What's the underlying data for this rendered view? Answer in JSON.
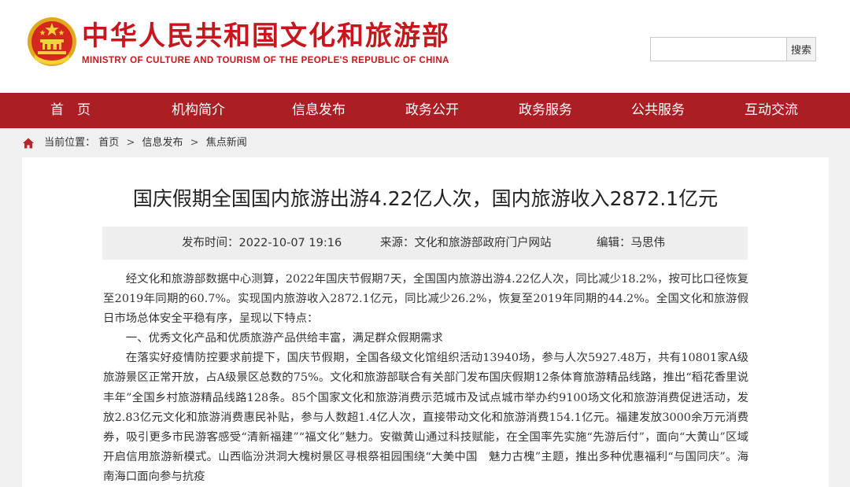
{
  "header": {
    "site_title_cn": "中华人民共和国文化和旅游部",
    "site_title_en": "MINISTRY OF CULTURE AND TOURISM OF THE PEOPLE'S REPUBLIC OF CHINA",
    "emblem_icon": "national-emblem-icon",
    "brand_color": "#c8161d"
  },
  "search": {
    "placeholder": "",
    "value": "",
    "button_label": "搜索"
  },
  "nav": {
    "background": "#ab1f24",
    "items": [
      "首　页",
      "机构简介",
      "信息发布",
      "政务公开",
      "政务服务",
      "公共服务",
      "互动交流"
    ]
  },
  "breadcrumb": {
    "icon": "home-icon",
    "prefix": "当前位置：",
    "items": [
      "首页",
      "信息发布",
      "焦点新闻"
    ],
    "separator": ">"
  },
  "article": {
    "title": "国庆假期全国国内旅游出游4.22亿人次，国内旅游收入2872.1亿元",
    "meta": {
      "publish_time_label": "发布时间：",
      "publish_time": "2022-10-07 19:16",
      "source_label": "来源：",
      "source": "文化和旅游部政府门户网站",
      "editor_label": "编辑：",
      "editor": "马思伟"
    },
    "paragraphs": [
      "经文化和旅游部数据中心测算，2022年国庆节假期7天，全国国内旅游出游4.22亿人次，同比减少18.2%，按可比口径恢复至2019年同期的60.7%。实现国内旅游收入2872.1亿元，同比减少26.2%，恢复至2019年同期的44.2%。全国文化和旅游假日市场总体安全平稳有序，呈现以下特点：",
      "一、优秀文化产品和优质旅游产品供给丰富，满足群众假期需求",
      "在落实好疫情防控要求前提下，国庆节假期，全国各级文化馆组织活动13940场，参与人次5927.48万，共有10801家A级旅游景区正常开放，占A级景区总数的75%。文化和旅游部联合有关部门发布国庆假期12条体育旅游精品线路，推出“稻花香里说丰年”全国乡村旅游精品线路128条。85个国家文化和旅游消费示范城市及试点城市举办约9100场文化和旅游消费促进活动，发放2.83亿元文化和旅游消费惠民补贴，参与人数超1.4亿人次，直接带动文化和旅游消费154.1亿元。福建发放3000余万元消费券，吸引更多市民游客感受“清新福建”“福文化”魅力。安徽黄山通过科技赋能，在全国率先实施“先游后付”，面向“大黄山”区域开启信用旅游新模式。山西临汾洪洞大槐树景区寻根祭祖园围绕“大美中国　魅力古槐”主题，推出多种优惠福利“与国同庆”。海南海口面向参与抗疫"
    ]
  }
}
